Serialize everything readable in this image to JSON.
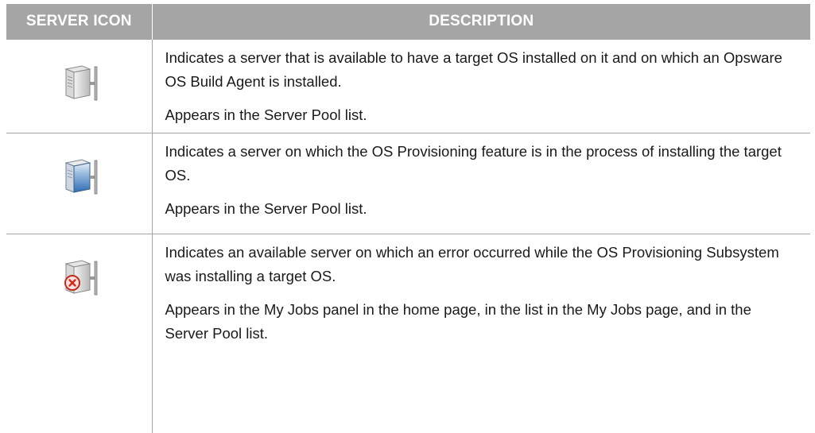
{
  "table": {
    "headers": {
      "icon": "SERVER ICON",
      "description": "DESCRIPTION"
    },
    "rows": [
      {
        "icon": "server-available-icon",
        "description": "Indicates a server that is available to have a target OS installed on it and on which an Opsware OS Build Agent is installed.",
        "note": "Appears in the Server Pool list."
      },
      {
        "icon": "server-installing-icon",
        "description": "Indicates a server on which the OS Provisioning feature is in the process of installing the target OS.",
        "note": "Appears in the Server Pool list."
      },
      {
        "icon": "server-error-icon",
        "description": "Indicates an available server on which an error occurred while the OS Provisioning Subsystem was installing a target OS.",
        "note": "Appears in the My Jobs panel in the home page, in the list in the My Jobs page, and in the Server Pool list."
      }
    ]
  },
  "colors": {
    "header_bg": "#a5a5a5",
    "header_text": "#ffffff",
    "border": "#a5a5a5",
    "installing_blue": "#3f7fc4",
    "error_red": "#d8281f"
  }
}
